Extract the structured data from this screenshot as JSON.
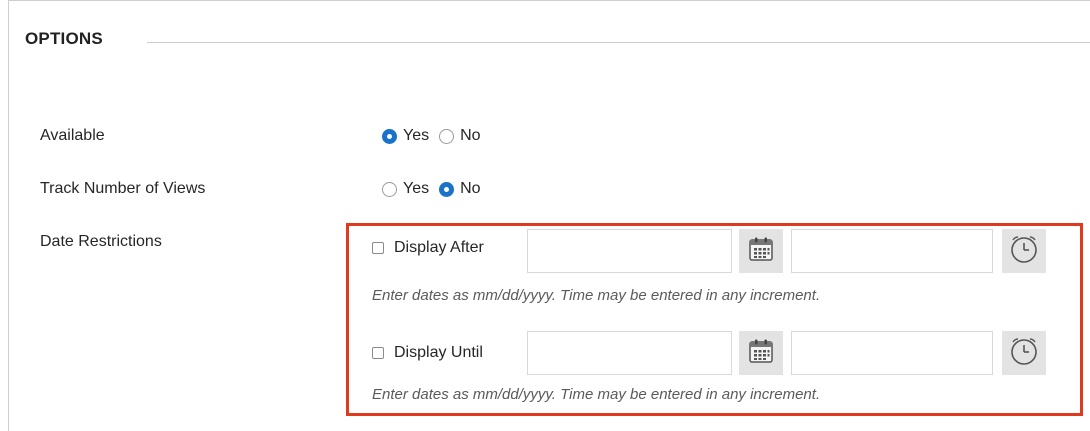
{
  "section": {
    "title": "OPTIONS"
  },
  "available": {
    "label": "Available",
    "options": [
      {
        "label": "Yes",
        "checked": true
      },
      {
        "label": "No",
        "checked": false
      }
    ]
  },
  "track_views": {
    "label": "Track Number of Views",
    "options": [
      {
        "label": "Yes",
        "checked": false
      },
      {
        "label": "No",
        "checked": true
      }
    ]
  },
  "date_restrictions": {
    "label": "Date Restrictions",
    "display_after": {
      "label": "Display After",
      "checked": false,
      "date_value": "",
      "time_value": "",
      "hint": "Enter dates as mm/dd/yyyy. Time may be entered in any increment."
    },
    "display_until": {
      "label": "Display Until",
      "checked": false,
      "date_value": "",
      "time_value": "",
      "hint": "Enter dates as mm/dd/yyyy. Time may be entered in any increment."
    }
  },
  "colors": {
    "accent": "#1a73c8",
    "highlight": "#e03a1e",
    "icon_bg": "#e3e3e3"
  },
  "icons": {
    "calendar": "calendar-icon",
    "clock": "clock-icon"
  }
}
